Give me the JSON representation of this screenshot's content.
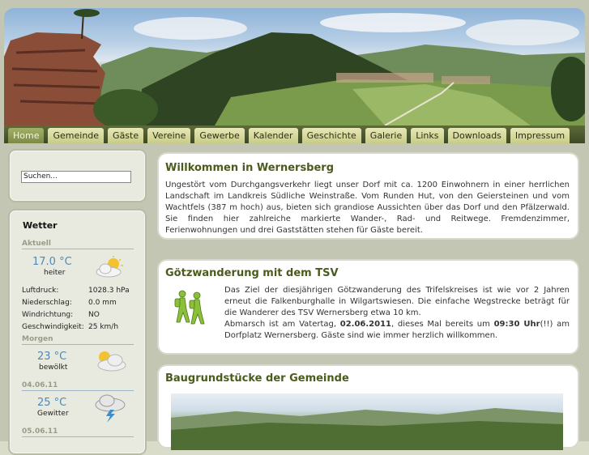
{
  "nav": {
    "items": [
      "Home",
      "Gemeinde",
      "Gäste",
      "Vereine",
      "Gewerbe",
      "Kalender",
      "Geschichte",
      "Galerie",
      "Links",
      "Downloads",
      "Impressum"
    ],
    "active": "Home"
  },
  "search": {
    "placeholder": "Suchen..."
  },
  "weather": {
    "title": "Wetter",
    "current": {
      "label": "Aktuell",
      "temp": "17.0 °C",
      "desc": "heiter",
      "icon": "sun-cloud-icon",
      "details": [
        {
          "label": "Luftdruck:",
          "value": "1028.3 hPa"
        },
        {
          "label": "Niederschlag:",
          "value": "0.0 mm"
        },
        {
          "label": "Windrichtung:",
          "value": "NO"
        },
        {
          "label": "Geschwindigkeit:",
          "value": "25 km/h"
        }
      ]
    },
    "forecast": [
      {
        "label": "Morgen",
        "temp": "23 °C",
        "desc": "bewölkt",
        "icon": "cloudy-sun-icon"
      },
      {
        "label": "04.06.11",
        "temp": "25 °C",
        "desc": "Gewitter",
        "icon": "thunderstorm-icon"
      },
      {
        "label": "05.06.11"
      }
    ]
  },
  "articles": [
    {
      "title": "Willkommen in Wernersberg",
      "text": "Ungestört vom Durchgangsverkehr liegt unser Dorf mit ca. 1200 Einwohnern in einer herrlichen Landschaft im Landkreis Südliche Weinstraße. Vom Runden Hut, von den Geiersteinen und vom Wachtfels (387 m hoch) aus, bieten sich grandiose Aussichten über das Dorf und den Pfälzerwald. Sie finden hier zahlreiche markierte Wander-, Rad- und Reitwege. Fremdenzimmer, Ferienwohnungen und drei Gaststätten stehen für Gäste bereit."
    },
    {
      "title": "Götzwanderung mit dem TSV",
      "text1": "Das Ziel der diesjährigen Götzwanderung des Trifelskreises ist wie vor 2 Jahren erneut die Falkenburghalle in Wilgartswiesen. Die einfache Wegstrecke beträgt für die Wanderer des TSV Wernersberg etwa 10 km.",
      "text2a": "Abmarsch ist am Vatertag, ",
      "text2b": "02.06.2011",
      "text2c": ", dieses Mal bereits um ",
      "text2d": "09:30 Uhr",
      "text2e": "(!!) am Dorfplatz Wernersberg. Gäste sind wie immer herzlich willkommen."
    },
    {
      "title": "Baugrundstücke der Gemeinde"
    }
  ],
  "colors": {
    "nav_bg": "#4a5730",
    "nav_tab": "#d8db9f",
    "title": "#4b5a1d",
    "temp": "#4f88b8"
  }
}
